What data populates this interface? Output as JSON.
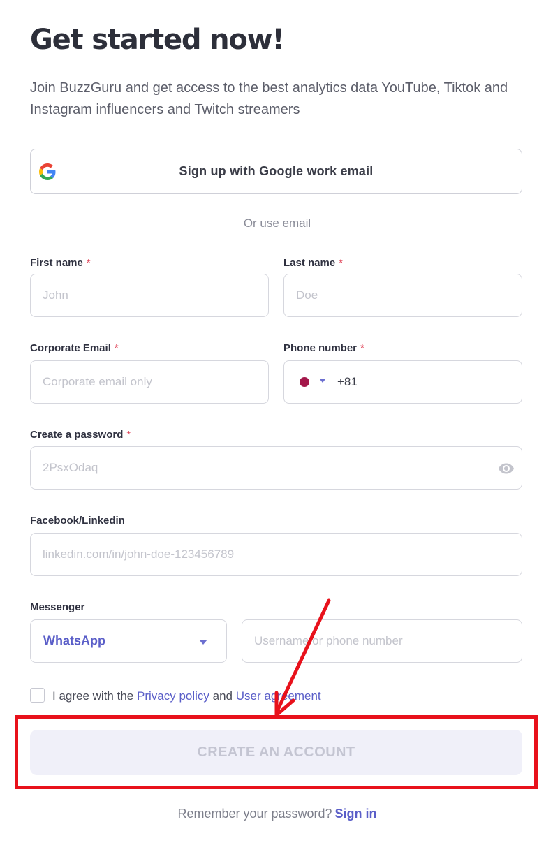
{
  "header": {
    "title": "Get started now!",
    "subtitle": "Join BuzzGuru and get access to the best analytics data YouTube, Tiktok and Instagram influencers and Twitch streamers"
  },
  "google": {
    "label": "Sign up with Google work email",
    "icon": "google-icon"
  },
  "divider_text": "Or use email",
  "required_mark": "*",
  "form": {
    "first_name": {
      "label": "First name",
      "placeholder": "John"
    },
    "last_name": {
      "label": "Last name",
      "placeholder": "Doe"
    },
    "email": {
      "label": "Corporate Email",
      "placeholder": "Corporate email only"
    },
    "phone": {
      "label": "Phone number",
      "code": "+81",
      "flag_color": "#a3174a"
    },
    "password": {
      "label": "Create a password",
      "placeholder": "2PsxOdaq"
    },
    "social": {
      "label": "Facebook/Linkedin",
      "placeholder": "linkedin.com/in/john-doe-123456789"
    },
    "messenger": {
      "label": "Messenger",
      "selected": "WhatsApp",
      "placeholder": "Username or phone number"
    }
  },
  "agreement": {
    "prefix": "I agree with the",
    "privacy": "Privacy policy",
    "and": "and",
    "user_agreement": "User agreement",
    "checked": false
  },
  "create_button": "CREATE AN ACCOUNT",
  "footer": {
    "text": "Remember your password?",
    "link": "Sign in"
  },
  "colors": {
    "accent": "#5a5ec8",
    "required": "#e0465a",
    "annotation": "#e8111b",
    "disabled_button_bg": "#f0f0f9"
  }
}
